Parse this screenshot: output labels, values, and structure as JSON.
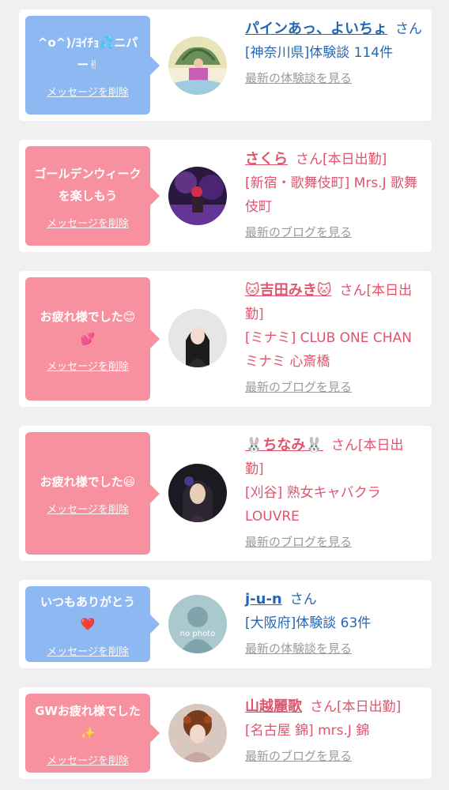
{
  "cards": [
    {
      "bubble_text": "^o^)/ﾖｲﾁｮ💦ニパー✌",
      "delete_label": "メッセージを削除",
      "name": "パインあっ、よいちょ",
      "suffix": "さん",
      "sub": "[神奈川県]体験談 114件",
      "more": "最新の体験談を見る",
      "theme": "blue"
    },
    {
      "bubble_text": "ゴールデンウィークを楽しもう",
      "delete_label": "メッセージを削除",
      "name": "さくら",
      "suffix": "さん[本日出勤]",
      "sub": "[新宿・歌舞伎町] Mrs.J 歌舞伎町",
      "more": "最新のブログを見る",
      "theme": "pink"
    },
    {
      "bubble_text": "お疲れ様でした😊💕",
      "delete_label": "メッセージを削除",
      "name": "🐱吉田みき🐱",
      "suffix": "さん[本日出勤]",
      "sub": "[ミナミ] CLUB ONE CHAN ミナミ 心斎橋",
      "more": "最新のブログを見る",
      "theme": "pink"
    },
    {
      "bubble_text": "お疲れ様でした😃",
      "delete_label": "メッセージを削除",
      "name": "🐰ちなみ🐰",
      "suffix": "さん[本日出勤]",
      "sub": "[刈谷] 熟女キャバクラ LOUVRE",
      "more": "最新のブログを見る",
      "theme": "pink"
    },
    {
      "bubble_text": "いつもありがとう❤️",
      "delete_label": "メッセージを削除",
      "name": "j-u-n",
      "suffix": "さん",
      "sub": "[大阪府]体験談 63件",
      "more": "最新の体験談を見る",
      "avatar_text": "no photo",
      "theme": "blue"
    },
    {
      "bubble_text": "GWお疲れ様でした✨",
      "delete_label": "メッセージを削除",
      "name": "山越麗歌",
      "suffix": "さん[本日出勤]",
      "sub": "[名古屋 錦] mrs.J 錦",
      "more": "最新のブログを見る",
      "theme": "pink"
    }
  ]
}
